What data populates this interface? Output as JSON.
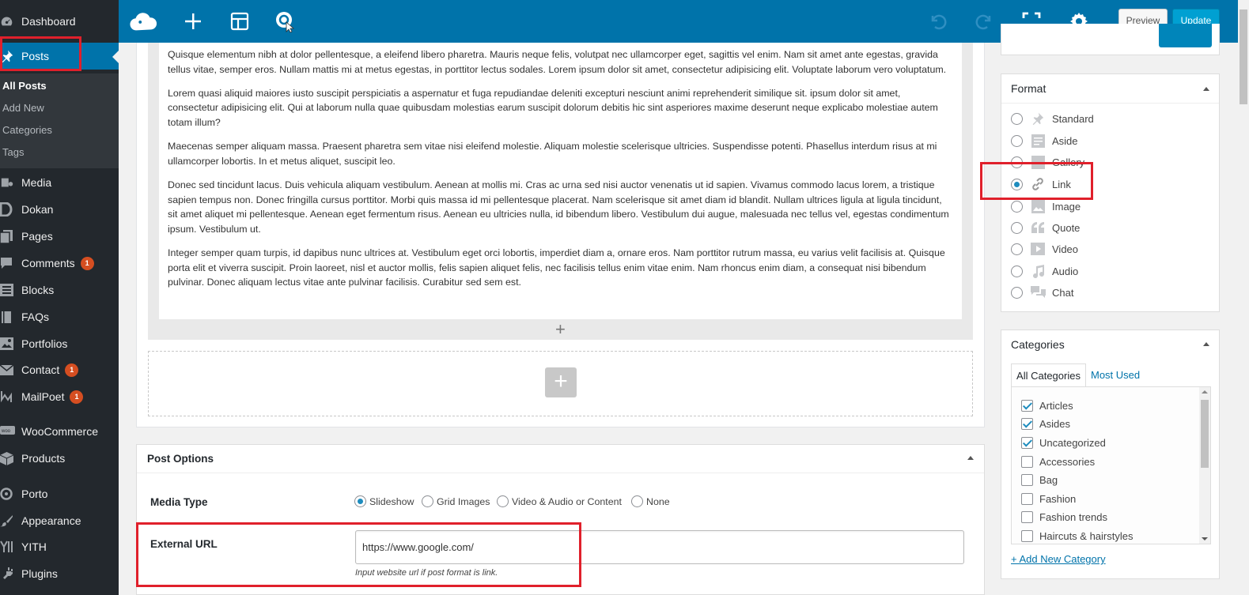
{
  "sidebar": {
    "items": [
      {
        "label": "Dashboard",
        "icon": "dashboard-icon"
      },
      {
        "label": "Posts",
        "icon": "pin-icon",
        "active": true
      },
      {
        "label": "Media",
        "icon": "media-icon"
      },
      {
        "label": "Dokan",
        "icon": "dokan-icon"
      },
      {
        "label": "Pages",
        "icon": "pages-icon"
      },
      {
        "label": "Comments",
        "icon": "comment-icon",
        "badge": "1"
      },
      {
        "label": "Blocks",
        "icon": "blocks-icon"
      },
      {
        "label": "FAQs",
        "icon": "book-icon"
      },
      {
        "label": "Portfolios",
        "icon": "portfolio-icon"
      },
      {
        "label": "Contact",
        "icon": "mail-icon",
        "badge": "1"
      },
      {
        "label": "MailPoet",
        "icon": "mailpoet-icon",
        "badge": "1"
      },
      {
        "label": "WooCommerce",
        "icon": "woo-icon"
      },
      {
        "label": "Products",
        "icon": "box-icon"
      },
      {
        "label": "Porto",
        "icon": "porto-icon"
      },
      {
        "label": "Appearance",
        "icon": "brush-icon"
      },
      {
        "label": "YITH",
        "icon": "yith-icon"
      },
      {
        "label": "Plugins",
        "icon": "plugin-icon"
      }
    ],
    "submenu": [
      "All Posts",
      "Add New",
      "Categories",
      "Tags"
    ]
  },
  "toolbar": {
    "icons": [
      "logo-icon",
      "add-block-icon",
      "layout-icon",
      "navigation-icon",
      "undo-icon",
      "redo-icon",
      "fullscreen-icon",
      "settings-gear-icon"
    ],
    "preview_label": "Preview",
    "update_label": "Update"
  },
  "content": {
    "paragraphs": [
      "Quisque elementum nibh at dolor pellentesque, a eleifend libero pharetra. Mauris neque felis, volutpat nec ullamcorper eget, sagittis vel enim. Nam sit amet ante egestas, gravida tellus vitae, semper eros. Nullam mattis mi at metus egestas, in porttitor lectus sodales. Lorem ipsum dolor sit amet, consectetur adipisicing elit. Voluptate laborum vero voluptatum.",
      "Lorem quasi aliquid maiores iusto suscipit perspiciatis a aspernatur et fuga repudiandae deleniti excepturi nesciunt animi reprehenderit similique sit. ipsum dolor sit amet, consectetur adipisicing elit. Qui at laborum nulla quae quibusdam molestias earum suscipit dolorum debitis hic sint asperiores maxime deserunt neque explicabo molestiae autem totam illum?",
      "Maecenas semper aliquam massa. Praesent pharetra sem vitae nisi eleifend molestie. Aliquam molestie scelerisque ultricies. Suspendisse potenti. Phasellus interdum risus at mi ullamcorper lobortis. In et metus aliquet, suscipit leo.",
      "Donec sed tincidunt lacus. Duis vehicula aliquam vestibulum. Aenean at mollis mi. Cras ac urna sed nisi auctor venenatis ut id sapien. Vivamus commodo lacus lorem, a tristique sapien tempus non. Donec fringilla cursus porttitor. Morbi quis massa id mi pellentesque placerat. Nam scelerisque sit amet diam id blandit. Nullam ultrices ligula at ligula tincidunt, sit amet aliquet mi pellentesque. Aenean eget fermentum risus. Aenean eu ultricies nulla, id bibendum libero. Vestibulum dui augue, malesuada nec tellus vel, egestas condimentum ipsum. Vestibulum ut.",
      "Integer semper quam turpis, id dapibus nunc ultrices at. Vestibulum eget orci lobortis, imperdiet diam a, ornare eros. Nam porttitor rutrum massa, eu varius velit facilisis at. Quisque porta elit et viverra suscipit. Proin laoreet, nisl et auctor mollis, felis sapien aliquet felis, nec facilisis tellus enim vitae enim. Nam rhoncus enim diam, a consequat nisi bibendum pulvinar. Donec aliquam lectus vitae ante pulvinar facilisis. Curabitur sed sem est."
    ],
    "inline_plus": "+",
    "add_block_plus": "+"
  },
  "post_options": {
    "title": "Post Options",
    "media_type_label": "Media Type",
    "media_type_options": [
      "Slideshow",
      "Grid Images",
      "Video & Audio or Content",
      "None"
    ],
    "media_type_selected": "Slideshow",
    "external_url_label": "External URL",
    "external_url_value": "https://www.google.com/",
    "external_url_help": "Input website url if post format is link."
  },
  "format": {
    "title": "Format",
    "options": [
      {
        "label": "Standard",
        "icon": "pin-icon"
      },
      {
        "label": "Aside",
        "icon": "aside-icon"
      },
      {
        "label": "Gallery",
        "icon": "gallery-icon"
      },
      {
        "label": "Link",
        "icon": "link-icon"
      },
      {
        "label": "Image",
        "icon": "image-icon"
      },
      {
        "label": "Quote",
        "icon": "quote-icon"
      },
      {
        "label": "Video",
        "icon": "video-icon"
      },
      {
        "label": "Audio",
        "icon": "audio-icon"
      },
      {
        "label": "Chat",
        "icon": "chat-icon"
      }
    ],
    "selected": "Link"
  },
  "categories": {
    "title": "Categories",
    "tabs": [
      "All Categories",
      "Most Used"
    ],
    "items": [
      {
        "label": "Articles",
        "checked": true
      },
      {
        "label": "Asides",
        "checked": true
      },
      {
        "label": "Uncategorized",
        "checked": true
      },
      {
        "label": "Accessories",
        "checked": false
      },
      {
        "label": "Bag",
        "checked": false
      },
      {
        "label": "Fashion",
        "checked": false
      },
      {
        "label": "Fashion trends",
        "checked": false
      },
      {
        "label": "Haircuts & hairstyles",
        "checked": false
      }
    ],
    "add_new_label": "+ Add New Category"
  },
  "colors": {
    "sidebar_bg": "#23282d",
    "toolbar_blue": "#0073aa",
    "highlight_red": "#e0202b",
    "update_blue": "#00a0d2"
  }
}
